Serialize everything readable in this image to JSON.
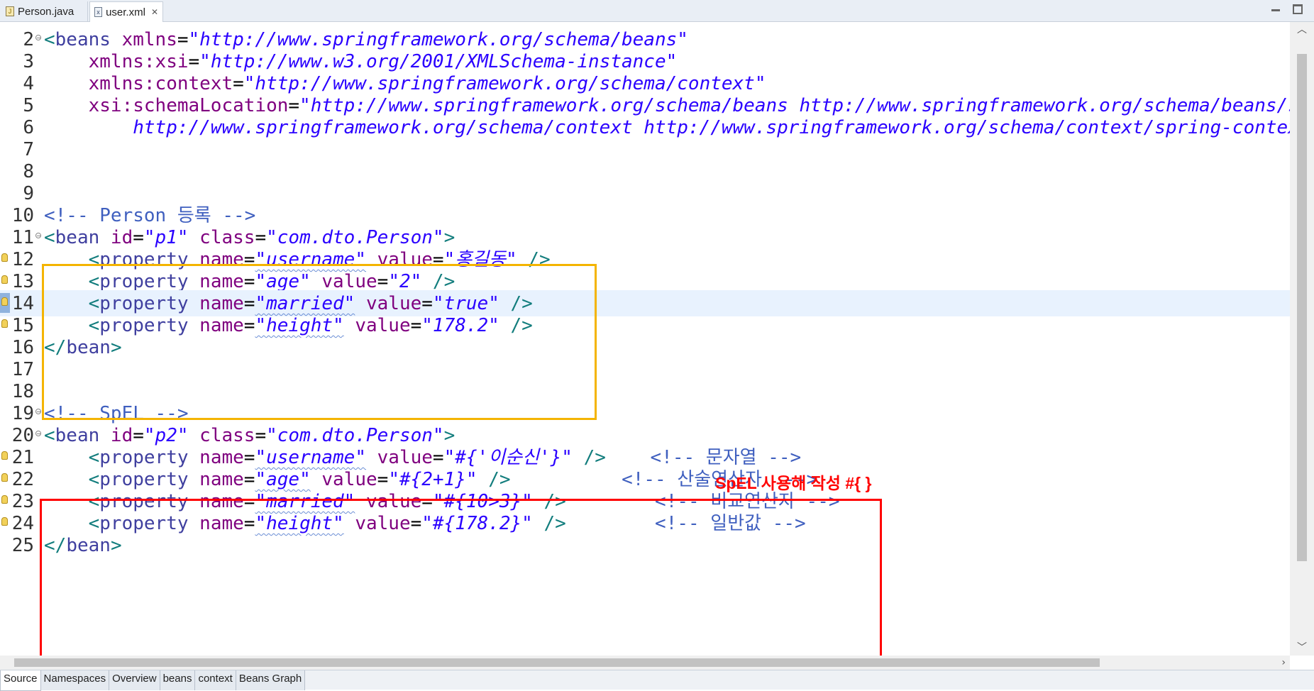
{
  "tabs": [
    {
      "label": "Person.java",
      "active": false
    },
    {
      "label": "user.xml",
      "active": true
    }
  ],
  "gutter": {
    "line_numbers": [
      "2",
      "3",
      "4",
      "5",
      "6",
      "7",
      "8",
      "9",
      "10",
      "11",
      "12",
      "13",
      "14",
      "15",
      "16",
      "17",
      "18",
      "19",
      "20",
      "21",
      "22",
      "23",
      "24",
      "25"
    ]
  },
  "code": {
    "l2": {
      "open": "<",
      "el": "beans",
      "a1": " xmlns",
      "eq": "=",
      "v1": "\"http://www.springframework.org/schema/beans\""
    },
    "l3": {
      "a1": "xmlns:xsi",
      "eq": "=",
      "v1": "\"http://www.w3.org/2001/XMLSchema-instance\""
    },
    "l4": {
      "a1": "xmlns:context",
      "eq": "=",
      "v1": "\"http://www.springframework.org/schema/context\""
    },
    "l5": {
      "a1": "xsi:schemaLocation",
      "eq": "=",
      "v1": "\"http://www.springframework.org/schema/beans http://www.springframework.org/schema/beans/spring-beans.xsd"
    },
    "l6": {
      "v1": "http://www.springframework.org/schema/context http://www.springframework.org/schema/context/spring-context.xsd\">"
    },
    "l10": {
      "comment": "<!-- Person 등록 -->"
    },
    "l11": {
      "open": "<",
      "el": "bean",
      "a1": " id",
      "eq1": "=",
      "v1": "\"p1\"",
      "a2": " class",
      "eq2": "=",
      "v2": "\"com.dto.Person\"",
      "close": ">"
    },
    "l12": {
      "open": "<",
      "el": "property",
      "a1": " name",
      "eq1": "=",
      "v1": "\"username\"",
      "a2": " value",
      "eq2": "=",
      "v2": "\"홍길동\"",
      "close": " />"
    },
    "l13": {
      "open": "<",
      "el": "property",
      "a1": " name",
      "eq1": "=",
      "v1": "\"age\"",
      "a2": " value",
      "eq2": "=",
      "v2": "\"2\"",
      "close": " />"
    },
    "l14": {
      "open": "<",
      "el": "property",
      "a1": " name",
      "eq1": "=",
      "v1": "\"married\"",
      "a2": " value",
      "eq2": "=",
      "v2": "\"true\"",
      "close": " />"
    },
    "l15": {
      "open": "<",
      "el": "property",
      "a1": " name",
      "eq1": "=",
      "v1": "\"height\"",
      "a2": " value",
      "eq2": "=",
      "v2": "\"178.2\"",
      "close": " />"
    },
    "l16": {
      "open": "</",
      "el": "bean",
      "close": ">"
    },
    "l19": {
      "comment": "<!-- SpEL -->"
    },
    "l20": {
      "open": "<",
      "el": "bean",
      "a1": " id",
      "eq1": "=",
      "v1": "\"p2\"",
      "a2": " class",
      "eq2": "=",
      "v2": "\"com.dto.Person\"",
      "close": ">"
    },
    "l21": {
      "open": "<",
      "el": "property",
      "a1": " name",
      "eq1": "=",
      "v1": "\"username\"",
      "a2": " value",
      "eq2": "=",
      "v2": "\"#{'이순신'}\"",
      "close": " />",
      "comment": "<!-- 문자열 -->"
    },
    "l22": {
      "open": "<",
      "el": "property",
      "a1": " name",
      "eq1": "=",
      "v1": "\"age\"",
      "a2": " value",
      "eq2": "=",
      "v2": "\"#{2+1}\"",
      "close": " />",
      "comment": "<!-- 산술연산자  -->"
    },
    "l23": {
      "open": "<",
      "el": "property",
      "a1": " name",
      "eq1": "=",
      "v1": "\"married\"",
      "a2": " value",
      "eq2": "=",
      "v2": "\"#{10>3}\"",
      "close": " />",
      "comment": "<!-- 비교연산자 -->"
    },
    "l24": {
      "open": "<",
      "el": "property",
      "a1": " name",
      "eq1": "=",
      "v1": "\"height\"",
      "a2": " value",
      "eq2": "=",
      "v2": "\"#{178.2}\"",
      "close": " />",
      "comment": "<!-- 일반값 -->"
    },
    "l25": {
      "open": "</",
      "el": "bean",
      "close": ">"
    }
  },
  "annotation": {
    "text": "SpEL 사용해 작성 #{ }",
    "color": "#ff0000"
  },
  "annotation_boxes": {
    "box1_color": "#f4b400",
    "box2_color": "#ff0000"
  },
  "page_tabs": [
    {
      "label": "Source",
      "active": true
    },
    {
      "label": "Namespaces",
      "active": false
    },
    {
      "label": "Overview",
      "active": false
    },
    {
      "label": "beans",
      "active": false
    },
    {
      "label": "context",
      "active": false
    },
    {
      "label": "Beans Graph",
      "active": false
    }
  ],
  "icons": {
    "java_file": "java-file-icon",
    "xml_file": "xml-file-icon",
    "close": "close-icon",
    "minimize": "minimize-icon",
    "maximize": "maximize-icon"
  }
}
